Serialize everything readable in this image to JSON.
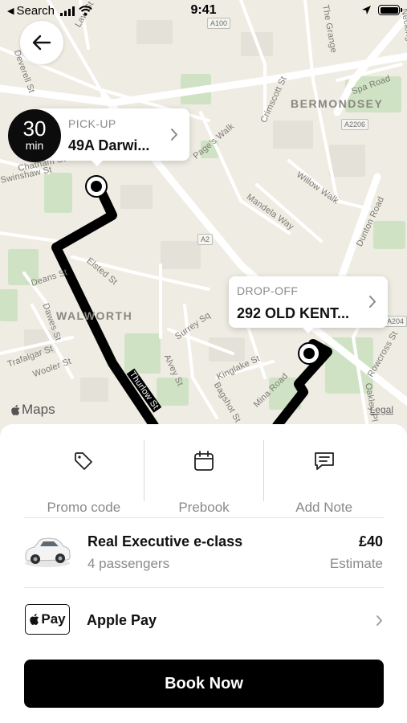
{
  "status_bar": {
    "back_app": "Search",
    "time": "9:41"
  },
  "map": {
    "area_labels": [
      "BERMONDSEY",
      "WALWORTH"
    ],
    "street_labels": [
      "Deverell St",
      "Chatham St",
      "Elsted St",
      "Deans St",
      "Trafalgar St",
      "Wooler St",
      "Dawes St",
      "Thurlow St",
      "Surrey Sq",
      "Alvey St",
      "Kinglake St",
      "Bagshot St",
      "Mina Road",
      "Page's Walk",
      "Crimscott St",
      "Mandela Way",
      "Willow Walk",
      "Dunton Road",
      "Spa Road",
      "The Grange",
      "Rowcross St",
      "Oakley Pl",
      "Law St",
      "Swinshaw St",
      "Neckinger"
    ],
    "road_badges": [
      "A100",
      "A2206",
      "A2",
      "A204"
    ],
    "maps_brand": "Maps",
    "legal": "Legal"
  },
  "eta": {
    "value": "30",
    "unit": "min"
  },
  "pickup": {
    "label": "PICK-UP",
    "value": "49A Darwi..."
  },
  "dropoff": {
    "label": "DROP-OFF",
    "value": "292 OLD KENT..."
  },
  "actions": [
    {
      "label": "Promo code",
      "icon": "tag-icon"
    },
    {
      "label": "Prebook",
      "icon": "calendar-icon"
    },
    {
      "label": "Add Note",
      "icon": "note-icon"
    }
  ],
  "vehicle": {
    "name": "Real Executive e-class",
    "passengers": "4 passengers",
    "price": "£40",
    "price_note": "Estimate"
  },
  "payment": {
    "badge": "Pay",
    "method": "Apple Pay"
  },
  "book_button": "Book Now"
}
